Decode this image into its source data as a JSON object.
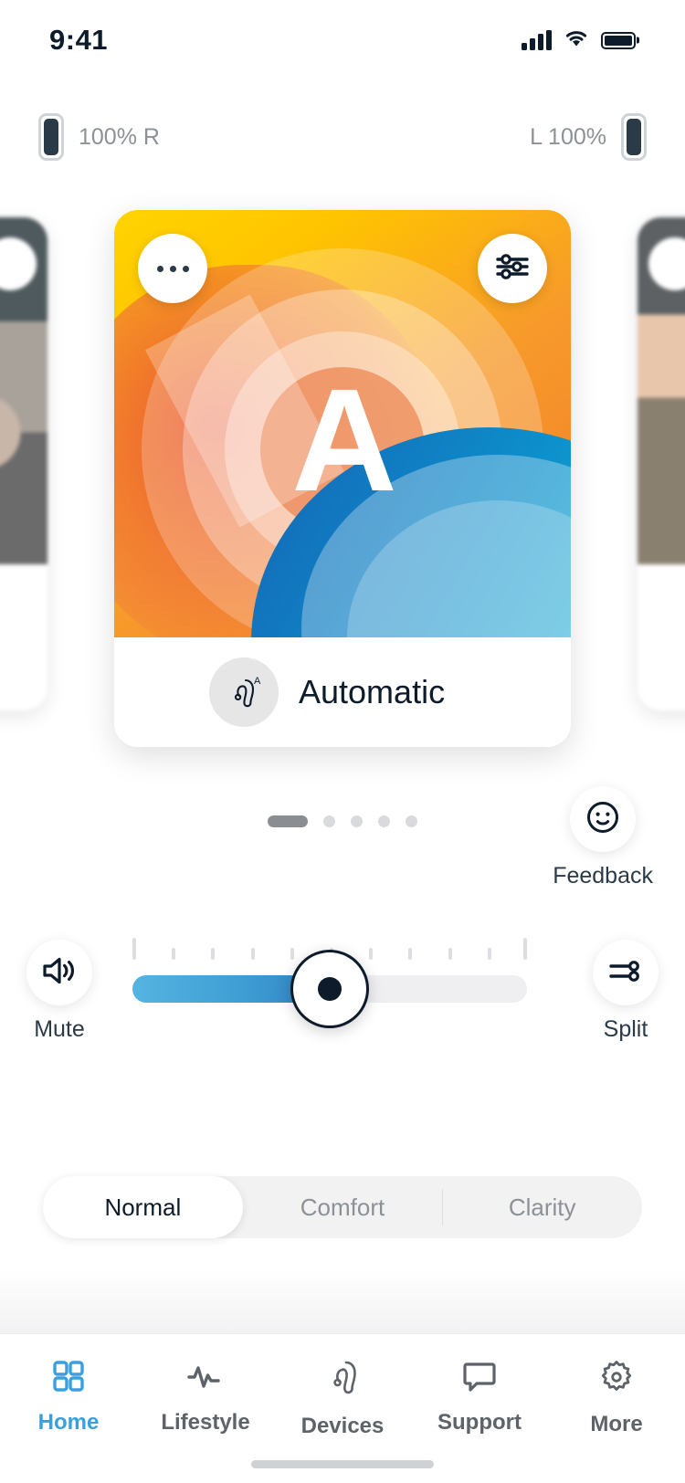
{
  "status_bar": {
    "time": "9:41",
    "signal_icon": "cellular-signal-icon",
    "wifi_icon": "wifi-icon",
    "battery_icon": "battery-icon"
  },
  "devices": {
    "right": {
      "label": "100% R",
      "icon": "right-hearing-aid-battery-icon"
    },
    "left": {
      "label": "L 100%",
      "icon": "left-hearing-aid-battery-icon"
    }
  },
  "program_card": {
    "letter": "A",
    "name": "Automatic",
    "badge_icon": "hearing-aid-program-icon",
    "more_icon": "more-options-icon",
    "tuner_icon": "equalizer-icon",
    "colors": {
      "yellow": "#FFD400",
      "orange": "#F07B28",
      "red": "#E94C39",
      "blue": "#0D8FCB",
      "cyan": "#2CC7D8"
    }
  },
  "pager": {
    "total": 5,
    "active_index": 0
  },
  "feedback": {
    "label": "Feedback",
    "icon": "smiley-face-icon"
  },
  "volume": {
    "mute": {
      "label": "Mute",
      "icon": "speaker-volume-icon"
    },
    "split": {
      "label": "Split",
      "icon": "split-sliders-icon"
    },
    "value_percent": 50,
    "tick_count": 11
  },
  "sound_modes": {
    "options": [
      "Normal",
      "Comfort",
      "Clarity"
    ],
    "selected": "Normal"
  },
  "bottom_nav": {
    "active": "Home",
    "active_color": "#3AA0DD",
    "items": [
      {
        "label": "Home",
        "icon": "grid-squares-icon"
      },
      {
        "label": "Lifestyle",
        "icon": "pulse-activity-icon"
      },
      {
        "label": "Devices",
        "icon": "hearing-aid-icon"
      },
      {
        "label": "Support",
        "icon": "speech-bubble-icon"
      },
      {
        "label": "More",
        "icon": "gear-icon"
      }
    ]
  }
}
